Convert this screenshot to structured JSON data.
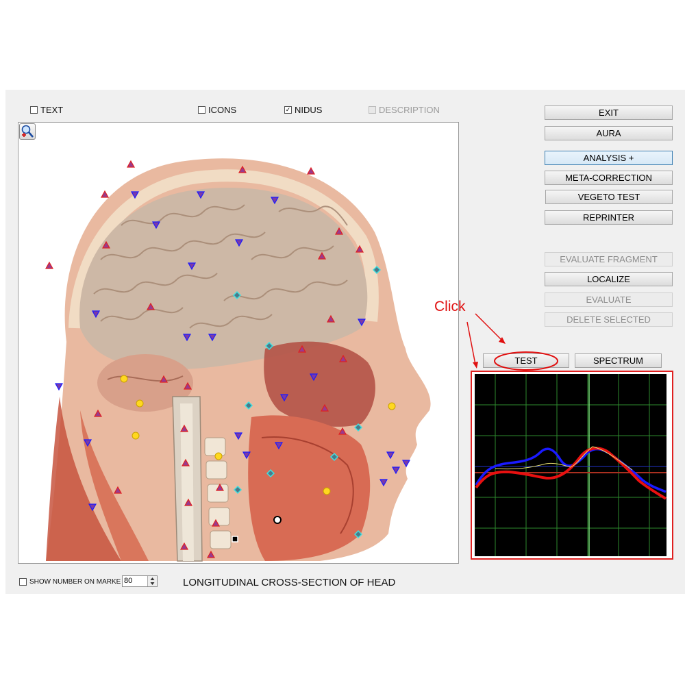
{
  "toolbar": {
    "text_label": "TEXT",
    "icons_label": "ICONS",
    "nidus_label": "NIDUS",
    "description_label": "DESCRIPTION",
    "nidus_checked": true
  },
  "buttons": {
    "exit": "EXIT",
    "aura": "AURA",
    "analysis": "ANALYSIS +",
    "meta_correction": "META-CORRECTION",
    "vegeto_test": "VEGETO TEST",
    "reprinter": "REPRINTER",
    "evaluate_fragment": "EVALUATE FRAGMENT",
    "localize": "LOCALIZE",
    "evaluate": "EVALUATE",
    "delete_selected": "DELETE SELECTED",
    "test": "TEST",
    "spectrum": "SPECTRUM"
  },
  "annotation": {
    "click_text": "Click"
  },
  "bottom": {
    "show_number_label": "SHOW NUMBER ON MARKE",
    "number_value": "80",
    "caption": "LONGITUDINAL CROSS-SECTION OF HEAD"
  },
  "icons": {
    "zoom": "magnifier-icon",
    "spinner": "spin-arrows-icon"
  },
  "colors": {
    "curve_red": "#e81010",
    "curve_blue": "#1a1aff",
    "curve_yellow": "#e8e070",
    "grid": "#2e8a2e",
    "annotation": "#e01010"
  }
}
